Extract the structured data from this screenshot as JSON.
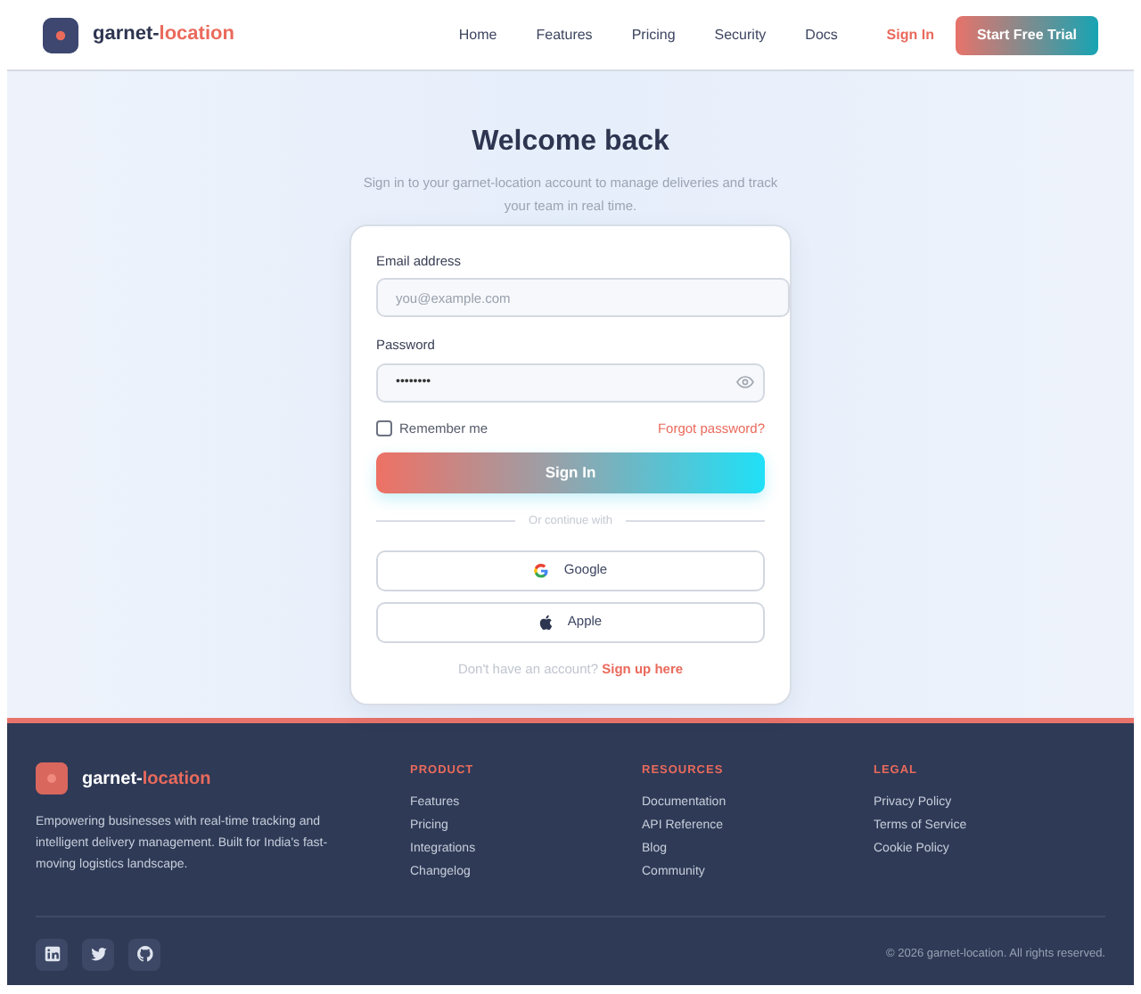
{
  "navbar": {
    "brand": {
      "lead": "garnet-",
      "accent": "location"
    },
    "links": [
      "Home",
      "Features",
      "Pricing",
      "Security",
      "Docs"
    ],
    "sign_in": "Sign In",
    "cta": "Start Free Trial"
  },
  "login": {
    "title": "Welcome back",
    "subtitle": "Sign in to your garnet-location account to manage deliveries and track your team in real time.",
    "email": {
      "label": "Email address",
      "placeholder": "you@example.com"
    },
    "password": {
      "label": "Password",
      "value": "••••••••"
    },
    "remember": {
      "label": "Remember me",
      "checked": false
    },
    "forgot": "Forgot password?",
    "submit": "Sign In",
    "divider": "Or continue with",
    "providers": [
      {
        "kind": "google",
        "label": "Google"
      },
      {
        "kind": "apple",
        "label": "Apple"
      }
    ],
    "signup_prompt": "Don't have an account?",
    "signup_link": "Sign up here"
  },
  "footer": {
    "brand": {
      "lead": "garnet-",
      "accent": "location"
    },
    "tagline": "Empowering businesses with real-time tracking and intelligent delivery management. Built for India's fast-moving logistics landscape.",
    "columns": [
      {
        "heading": "PRODUCT",
        "links": [
          "Features",
          "Pricing",
          "Integrations",
          "Changelog"
        ]
      },
      {
        "heading": "RESOURCES",
        "links": [
          "Documentation",
          "API Reference",
          "Blog",
          "Community"
        ]
      },
      {
        "heading": "LEGAL",
        "links": [
          "Privacy Policy",
          "Terms of Service",
          "Cookie Policy"
        ]
      }
    ],
    "socials": [
      {
        "kind": "linkedin"
      },
      {
        "kind": "twitter"
      },
      {
        "kind": "github"
      }
    ],
    "copyright": "© 2026 garnet-location. All rights reserved."
  }
}
